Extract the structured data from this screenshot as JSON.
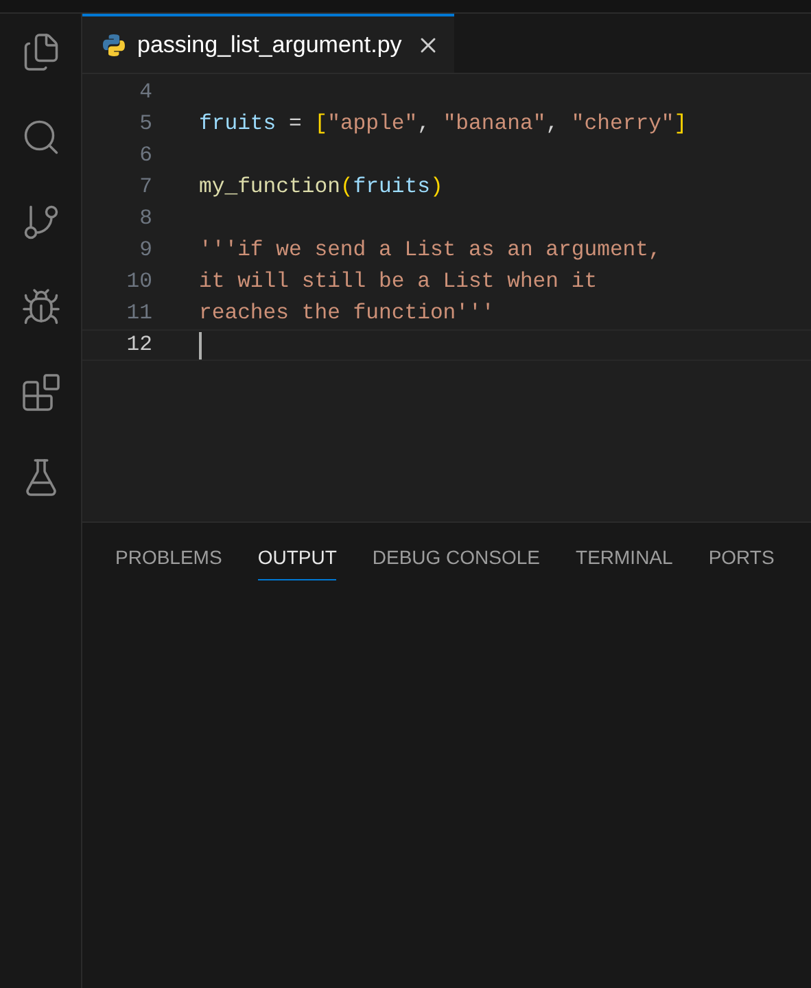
{
  "activity_bar": [
    {
      "kind": "files",
      "selected": false
    },
    {
      "kind": "search",
      "selected": false
    },
    {
      "kind": "source-control",
      "selected": false
    },
    {
      "kind": "run-debug",
      "selected": false
    },
    {
      "kind": "extensions",
      "selected": false
    },
    {
      "kind": "testing",
      "selected": false
    }
  ],
  "editor_tabs": [
    {
      "label": "passing_list_argument.py",
      "selected": true
    }
  ],
  "code_lines": [
    {
      "number": "4",
      "current": false
    },
    {
      "number": "5",
      "current": false,
      "tokens": [
        {
          "kind": "variable",
          "text": "fruits"
        },
        {
          "kind": "operator",
          "text": " = "
        },
        {
          "kind": "bracket",
          "text": "["
        },
        {
          "kind": "string",
          "text": "\"apple\""
        },
        {
          "kind": "operator",
          "text": ", "
        },
        {
          "kind": "string",
          "text": "\"banana\""
        },
        {
          "kind": "operator",
          "text": ", "
        },
        {
          "kind": "string",
          "text": "\"cherry\""
        },
        {
          "kind": "bracket",
          "text": "]"
        }
      ]
    },
    {
      "number": "6",
      "current": false
    },
    {
      "number": "7",
      "current": false,
      "tokens": [
        {
          "kind": "function",
          "text": "my_function"
        },
        {
          "kind": "bracket",
          "text": "("
        },
        {
          "kind": "variable",
          "text": "fruits"
        },
        {
          "kind": "bracket",
          "text": ")"
        }
      ]
    },
    {
      "number": "8",
      "current": false
    },
    {
      "number": "9",
      "current": false,
      "tokens": [
        {
          "kind": "string",
          "text": "'''if we send a List as an argument,"
        }
      ]
    },
    {
      "number": "10",
      "current": false,
      "tokens": [
        {
          "kind": "string",
          "text": "it will still be a List when it"
        }
      ]
    },
    {
      "number": "11",
      "current": false,
      "tokens": [
        {
          "kind": "string",
          "text": "reaches the function'''"
        }
      ]
    },
    {
      "number": "12",
      "current": true
    }
  ],
  "panel_tabs": [
    {
      "label": "PROBLEMS",
      "selected": false
    },
    {
      "label": "OUTPUT",
      "selected": true
    },
    {
      "label": "DEBUG CONSOLE",
      "selected": false
    },
    {
      "label": "TERMINAL",
      "selected": false
    },
    {
      "label": "PORTS",
      "selected": false
    }
  ]
}
